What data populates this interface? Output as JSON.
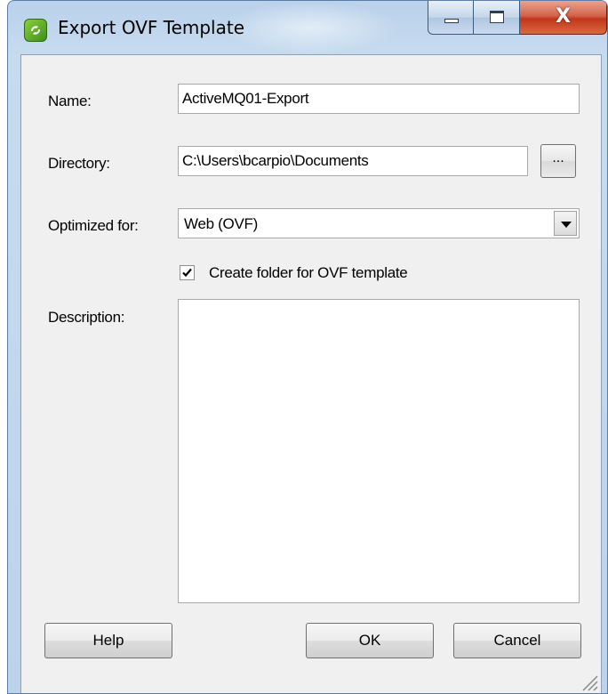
{
  "window": {
    "title": "Export OVF Template",
    "close_glyph": "X",
    "icons": {
      "app": "vsphere-client-icon",
      "minimize": "minimize-icon",
      "maximize": "maximize-icon",
      "close": "close-icon"
    }
  },
  "form": {
    "name": {
      "label": "Name:",
      "value": "ActiveMQ01-Export"
    },
    "directory": {
      "label": "Directory:",
      "value": "C:\\Users\\bcarpio\\Documents",
      "browse_label": "..."
    },
    "optimized_for": {
      "label": "Optimized for:",
      "selected": "Web (OVF)"
    },
    "create_folder": {
      "label": "Create folder for OVF template",
      "checked": true
    },
    "description": {
      "label": "Description:",
      "value": ""
    }
  },
  "buttons": {
    "help": "Help",
    "ok": "OK",
    "cancel": "Cancel"
  },
  "colors": {
    "accent_close": "#c2361b",
    "frame": "#b9d1ea",
    "client": "#f0f0f0"
  }
}
